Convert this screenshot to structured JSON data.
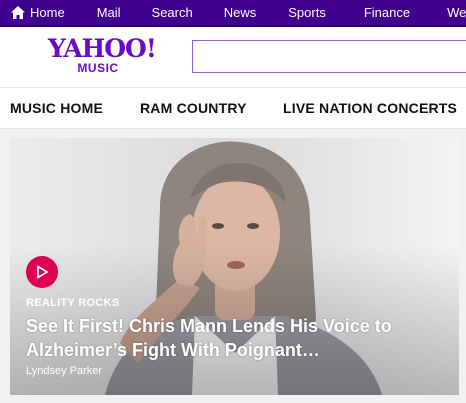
{
  "topnav": {
    "items": [
      {
        "label": "Home",
        "icon": "home-icon"
      },
      {
        "label": "Mail"
      },
      {
        "label": "Search"
      },
      {
        "label": "News"
      },
      {
        "label": "Sports"
      },
      {
        "label": "Finance"
      },
      {
        "label": "Weather"
      }
    ]
  },
  "header": {
    "logo_word": "YAHOO!",
    "logo_sub": "MUSIC",
    "search_value": ""
  },
  "section_nav": {
    "tabs": [
      {
        "label": "MUSIC HOME"
      },
      {
        "label": "RAM COUNTRY"
      },
      {
        "label": "LIVE NATION CONCERTS"
      }
    ]
  },
  "hero": {
    "kicker": "REALITY ROCKS",
    "headline": "See It First! Chris Mann Lends His Voice to Alzheimer’s Fight With Poignant…",
    "author": "Lyndsey Parker",
    "play_icon": "play-icon"
  },
  "colors": {
    "topnav_bg": "#400090",
    "brand": "#6b0ac9",
    "play_accent": "#e1004f"
  }
}
